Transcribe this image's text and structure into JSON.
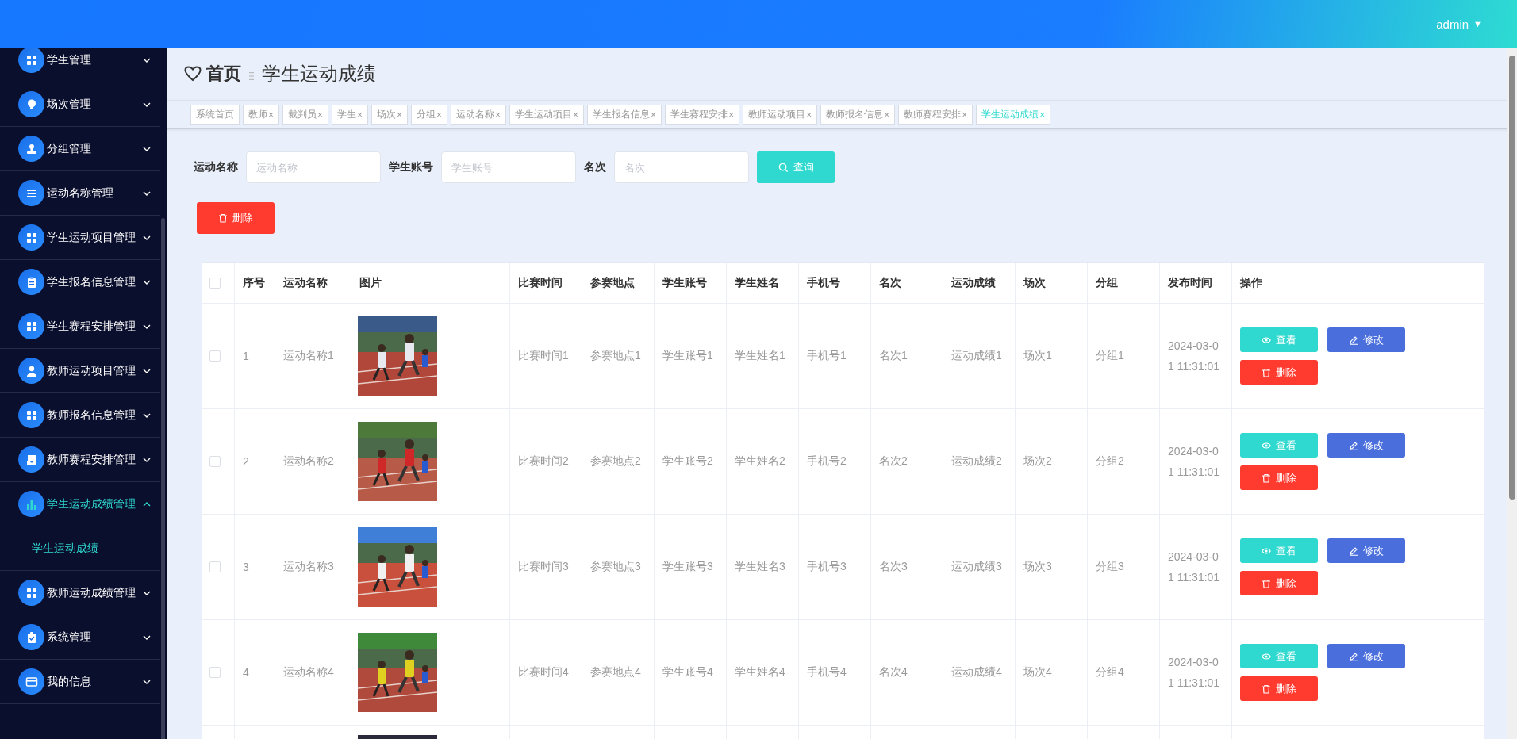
{
  "header": {
    "user": "admin",
    "caret": "▼"
  },
  "sidebar": {
    "items": [
      {
        "label": "学生管理",
        "expanded": false
      },
      {
        "label": "场次管理",
        "expanded": false
      },
      {
        "label": "分组管理",
        "expanded": false
      },
      {
        "label": "运动名称管理",
        "expanded": false
      },
      {
        "label": "学生运动项目管理",
        "expanded": false
      },
      {
        "label": "学生报名信息管理",
        "expanded": false
      },
      {
        "label": "学生赛程安排管理",
        "expanded": false
      },
      {
        "label": "教师运动项目管理",
        "expanded": false
      },
      {
        "label": "教师报名信息管理",
        "expanded": false
      },
      {
        "label": "教师赛程安排管理",
        "expanded": false
      },
      {
        "label": "学生运动成绩管理",
        "expanded": true,
        "children": [
          {
            "label": "学生运动成绩",
            "selected": true
          }
        ]
      },
      {
        "label": "教师运动成绩管理",
        "expanded": false
      },
      {
        "label": "系统管理",
        "expanded": false
      },
      {
        "label": "我的信息",
        "expanded": false
      }
    ]
  },
  "breadcrumb": {
    "home": "首页",
    "current": "学生运动成绩"
  },
  "tags": [
    {
      "label": "系统首页",
      "selected": false
    },
    {
      "label": "教师",
      "close": "×",
      "selected": false
    },
    {
      "label": "裁判员",
      "close": "×",
      "selected": false
    },
    {
      "label": "学生",
      "close": "×",
      "selected": false
    },
    {
      "label": "场次",
      "close": "×",
      "selected": false
    },
    {
      "label": "分组",
      "close": "×",
      "selected": false
    },
    {
      "label": "运动名称",
      "close": "×",
      "selected": false
    },
    {
      "label": "学生运动项目",
      "close": "×",
      "selected": false
    },
    {
      "label": "学生报名信息",
      "close": "×",
      "selected": false
    },
    {
      "label": "学生赛程安排",
      "close": "×",
      "selected": false
    },
    {
      "label": "教师运动项目",
      "close": "×",
      "selected": false
    },
    {
      "label": "教师报名信息",
      "close": "×",
      "selected": false
    },
    {
      "label": "教师赛程安排",
      "close": "×",
      "selected": false
    },
    {
      "label": "学生运动成绩",
      "close": "×",
      "selected": true
    }
  ],
  "search": {
    "fields": [
      {
        "label": "运动名称",
        "placeholder": "运动名称"
      },
      {
        "label": "学生账号",
        "placeholder": "学生账号"
      },
      {
        "label": "名次",
        "placeholder": "名次"
      }
    ],
    "button": "查询"
  },
  "delete_button": "删除",
  "table": {
    "all_checked": false,
    "columns": [
      "序号",
      "运动名称",
      "图片",
      "比赛时间",
      "参赛地点",
      "学生账号",
      "学生姓名",
      "手机号",
      "名次",
      "运动成绩",
      "场次",
      "分组",
      "发布时间",
      "操作"
    ],
    "rows": [
      {
        "checked": false,
        "cells": [
          "1",
          "运动名称1",
          null,
          "比赛时间1",
          "参赛地点1",
          "学生账号1",
          "学生姓名1",
          "手机号1",
          "名次1",
          "运动成绩1",
          "场次1",
          "分组1",
          "2024-03-01 11:31:01"
        ],
        "actions": [
          "查看",
          "修改",
          "删除"
        ]
      },
      {
        "checked": false,
        "cells": [
          "2",
          "运动名称2",
          null,
          "比赛时间2",
          "参赛地点2",
          "学生账号2",
          "学生姓名2",
          "手机号2",
          "名次2",
          "运动成绩2",
          "场次2",
          "分组2",
          "2024-03-01 11:31:01"
        ],
        "actions": [
          "查看",
          "修改",
          "删除"
        ]
      },
      {
        "checked": false,
        "cells": [
          "3",
          "运动名称3",
          null,
          "比赛时间3",
          "参赛地点3",
          "学生账号3",
          "学生姓名3",
          "手机号3",
          "名次3",
          "运动成绩3",
          "场次3",
          "分组3",
          "2024-03-01 11:31:01"
        ],
        "actions": [
          "查看",
          "修改",
          "删除"
        ]
      },
      {
        "checked": false,
        "cells": [
          "4",
          "运动名称4",
          null,
          "比赛时间4",
          "参赛地点4",
          "学生账号4",
          "学生姓名4",
          "手机号4",
          "名次4",
          "运动成绩4",
          "场次4",
          "分组4",
          "2024-03-01 11:31:01"
        ],
        "actions": [
          "查看",
          "修改",
          "删除"
        ]
      }
    ]
  }
}
